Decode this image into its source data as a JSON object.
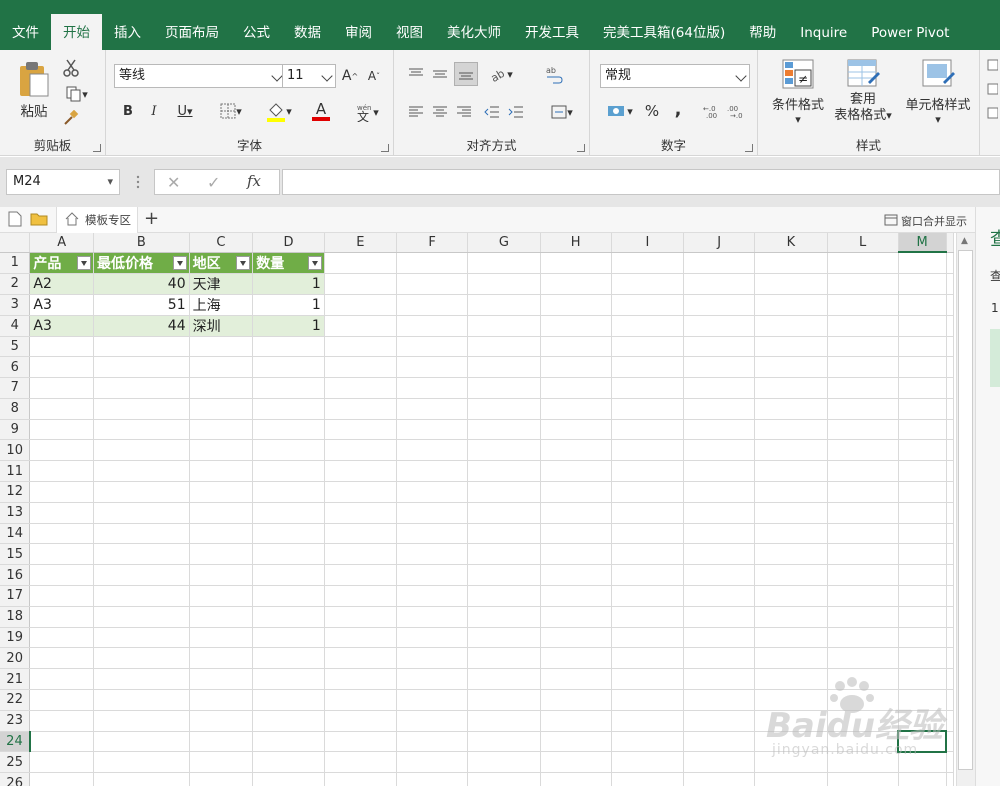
{
  "ribbon": {
    "tabs": [
      "文件",
      "开始",
      "插入",
      "页面布局",
      "公式",
      "数据",
      "审阅",
      "视图",
      "美化大师",
      "开发工具",
      "完美工具箱(64位版)",
      "帮助",
      "Inquire",
      "Power Pivot"
    ],
    "active_tab": "开始",
    "clipboard": {
      "paste_label": "粘贴",
      "group_label": "剪贴板"
    },
    "font": {
      "name": "等线",
      "size": "11",
      "bold": "B",
      "italic": "I",
      "underline": "U",
      "increase": "A",
      "decrease": "A",
      "font_color": "A",
      "group_label": "字体"
    },
    "alignment": {
      "group_label": "对齐方式"
    },
    "number": {
      "format": "常规",
      "percent": "%",
      "comma": ",",
      "group_label": "数字"
    },
    "styles": {
      "conditional_label": "条件格式",
      "table_label_1": "套用",
      "table_label_2": "表格格式",
      "cell_styles_label": "单元格样式",
      "group_label": "样式"
    }
  },
  "formula_bar": {
    "name_box": "M24",
    "formula": "",
    "fx_label": "fx"
  },
  "tabrow": {
    "template_label": "模板专区",
    "add_label": "+",
    "window_merge_label": "窗口合并显示"
  },
  "sidepane": {
    "chars": [
      "查",
      "查",
      "1"
    ]
  },
  "grid": {
    "columns": [
      "A",
      "B",
      "C",
      "D",
      "E",
      "F",
      "G",
      "H",
      "I",
      "J",
      "K",
      "L",
      "M"
    ],
    "selected_column": "M",
    "selected_row": 24,
    "row_numbers": [
      1,
      2,
      3,
      4,
      5,
      6,
      7,
      8,
      9,
      10,
      11,
      12,
      13,
      14,
      15,
      16,
      17,
      18,
      19,
      20,
      21,
      22,
      23,
      24,
      25,
      26
    ],
    "header": [
      "产品",
      "最低价格",
      "地区",
      "数量"
    ],
    "rows": [
      [
        "A2",
        "40",
        "天津",
        "1"
      ],
      [
        "A3",
        "51",
        "上海",
        "1"
      ],
      [
        "A3",
        "44",
        "深圳",
        "1"
      ]
    ]
  },
  "colors": {
    "accent": "#217346",
    "table_header": "#70ad47",
    "table_band": "#e2efda"
  },
  "watermark": {
    "text": "Baidu经验",
    "url": "jingyan.baidu.com"
  }
}
